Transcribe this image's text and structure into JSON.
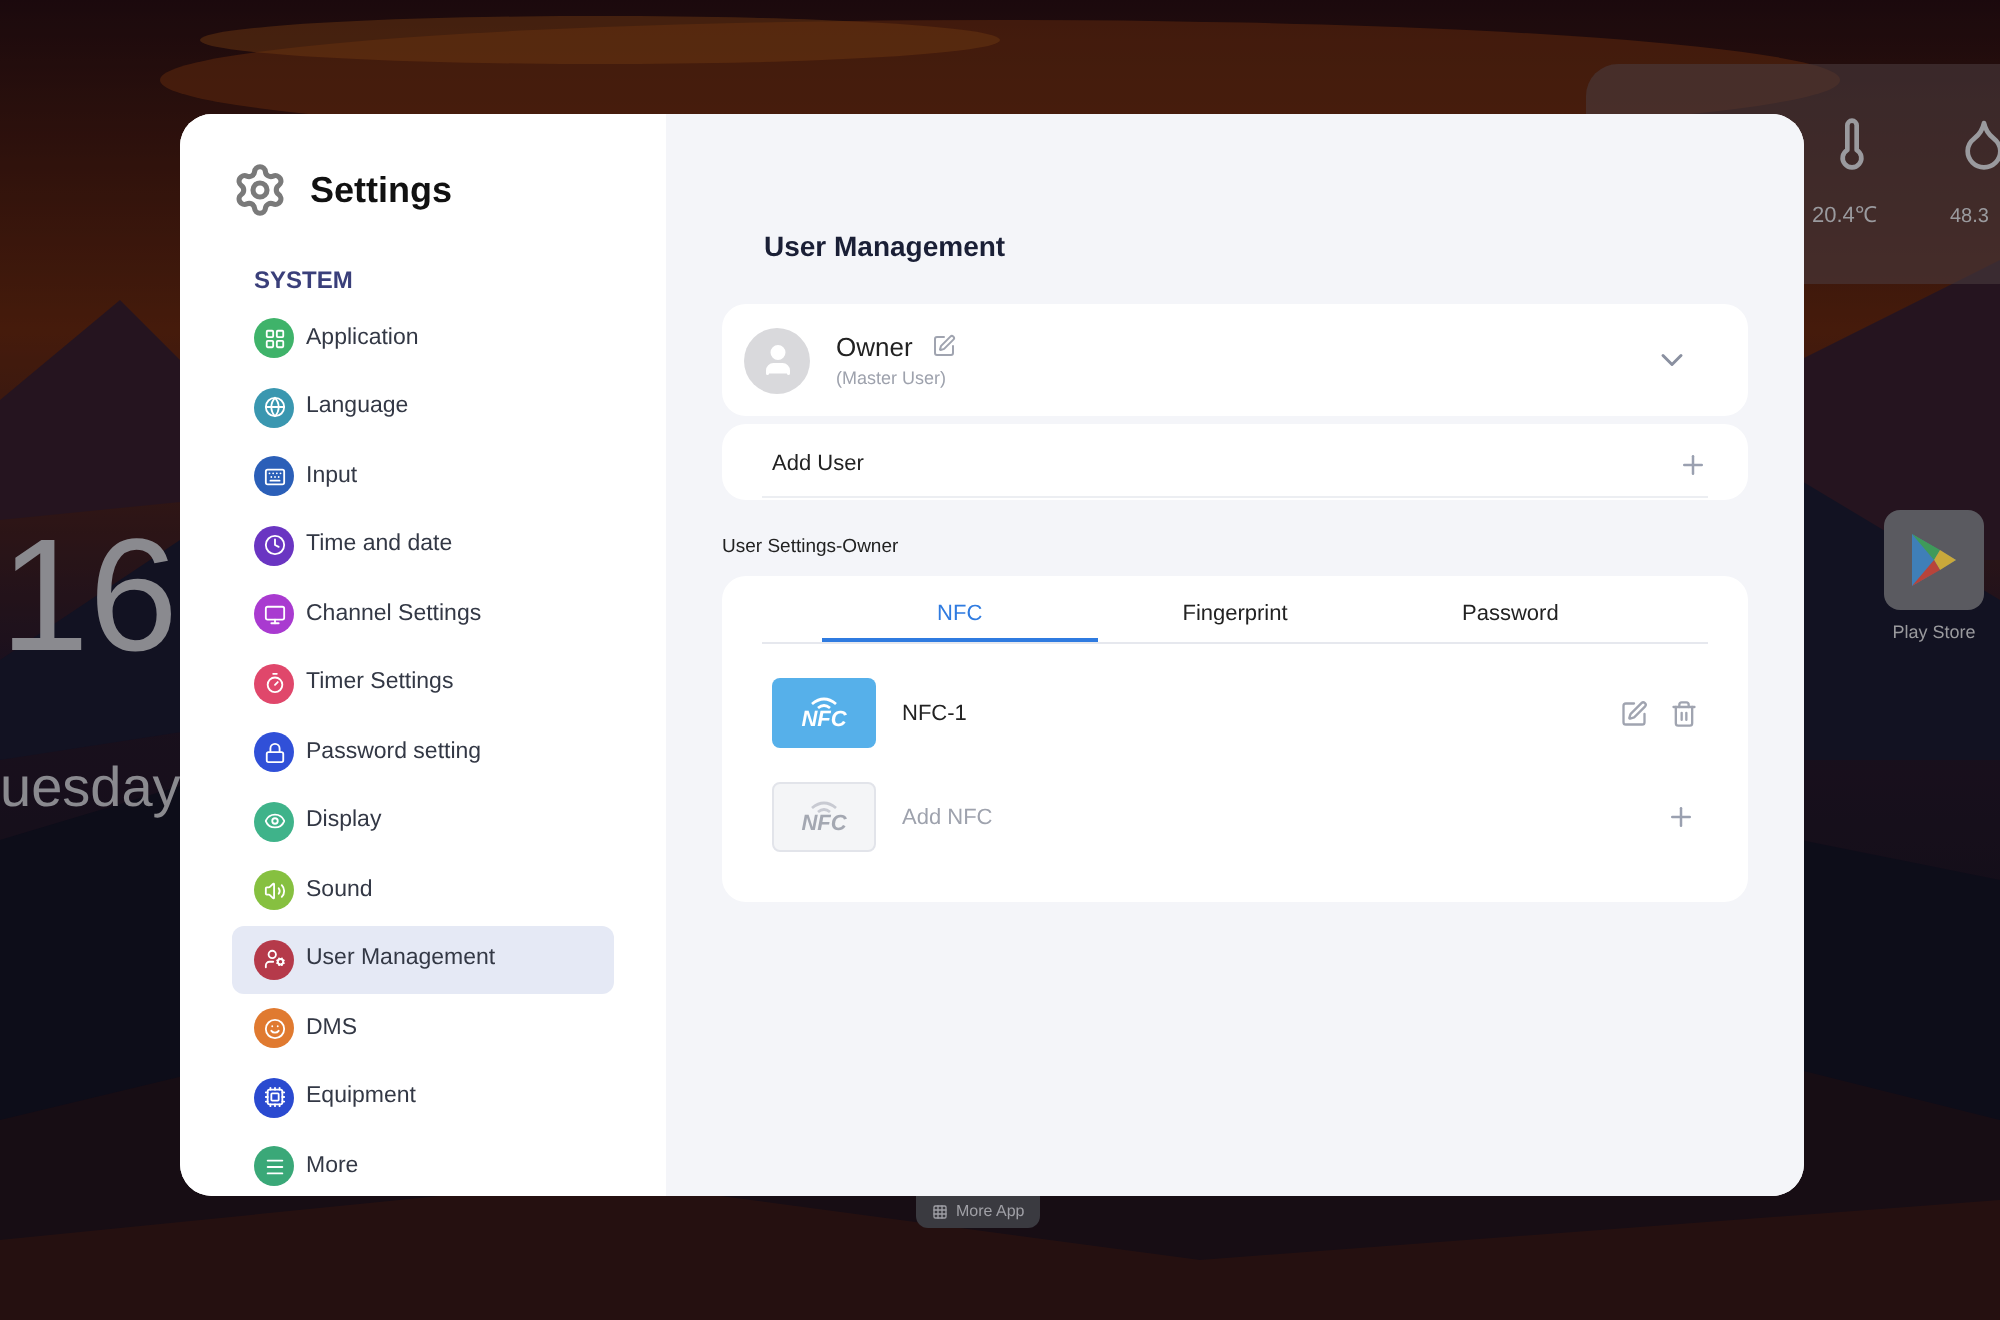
{
  "desktop": {
    "clock": "16",
    "weekday": "uesday",
    "weather": {
      "temperature": "20.4℃",
      "humidity": "48.3"
    },
    "apps": [
      {
        "label": "Play Store"
      }
    ],
    "dock": {
      "label": "More App"
    }
  },
  "window": {
    "title": "Settings"
  },
  "sidebar": {
    "section": "SYSTEM",
    "items": [
      {
        "label": "Application",
        "color": "#3fb36a",
        "selected": false
      },
      {
        "label": "Language",
        "color": "#3a97b0",
        "selected": false
      },
      {
        "label": "Input",
        "color": "#2b5fb8",
        "selected": false
      },
      {
        "label": "Time and date",
        "color": "#6a35c2",
        "selected": false
      },
      {
        "label": "Channel Settings",
        "color": "#a93ad0",
        "selected": false
      },
      {
        "label": "Timer Settings",
        "color": "#e0476b",
        "selected": false
      },
      {
        "label": "Password setting",
        "color": "#3050d8",
        "selected": false
      },
      {
        "label": "Display",
        "color": "#3fb38a",
        "selected": false
      },
      {
        "label": "Sound",
        "color": "#86c040",
        "selected": false
      },
      {
        "label": "User Management",
        "color": "#b53a4a",
        "selected": true
      },
      {
        "label": "DMS",
        "color": "#e07a30",
        "selected": false
      },
      {
        "label": "Equipment",
        "color": "#2a4ad0",
        "selected": false
      },
      {
        "label": "More",
        "color": "#3aa878",
        "selected": false
      }
    ]
  },
  "main": {
    "title": "User Management",
    "user": {
      "name": "Owner",
      "role": "(Master User)",
      "expanded": false
    },
    "add_user": {
      "label": "Add User"
    },
    "section_label": "User Settings-Owner",
    "tabs": [
      {
        "label": "NFC",
        "selected": true
      },
      {
        "label": "Fingerprint",
        "selected": false
      },
      {
        "label": "Password",
        "selected": false
      }
    ],
    "nfc_items": [
      {
        "kind": "card",
        "badge": "NFC",
        "label": "NFC-1"
      },
      {
        "kind": "add",
        "badge": "NFC",
        "label": "Add NFC"
      }
    ]
  }
}
